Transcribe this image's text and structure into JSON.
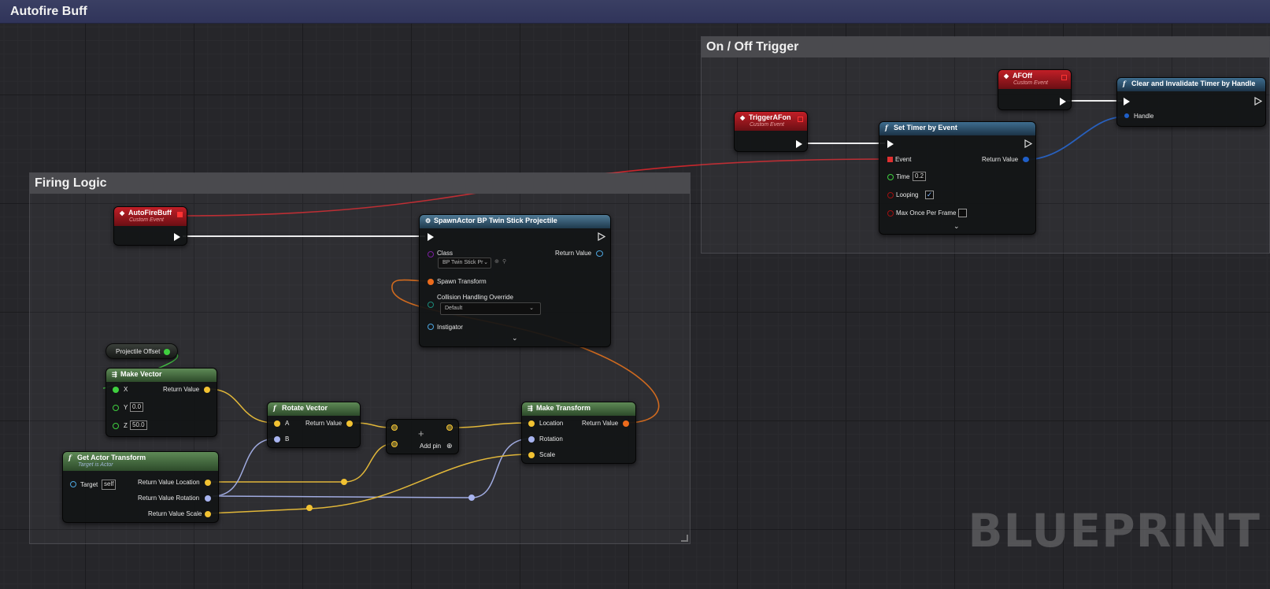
{
  "graph": {
    "title": "Autofire Buff"
  },
  "comments": {
    "on_off": "On / Off Trigger",
    "firing": "Firing Logic"
  },
  "nodes": {
    "af_off": {
      "title": "AFOff",
      "subtitle": "Custom Event"
    },
    "clear_timer": {
      "title": "Clear and Invalidate Timer by Handle",
      "handle": "Handle"
    },
    "trigger_af_on": {
      "title": "TriggerAFon",
      "subtitle": "Custom Event"
    },
    "set_timer": {
      "title": "Set Timer by Event",
      "event": "Event",
      "return_value": "Return Value",
      "time_label": "Time",
      "time_value": "0.2",
      "looping_label": "Looping",
      "looping_checked": true,
      "max_once_label": "Max Once Per Frame",
      "max_once_checked": false
    },
    "autofire_buff": {
      "title": "AutoFireBuff",
      "subtitle": "Custom Event"
    },
    "spawn_actor": {
      "title": "SpawnActor BP Twin Stick Projectile",
      "class_label": "Class",
      "class_value": "BP Twin Stick Pr",
      "return_value": "Return Value",
      "spawn_transform": "Spawn Transform",
      "collision_label": "Collision Handling Override",
      "collision_value": "Default",
      "instigator": "Instigator"
    },
    "projectile_offset": {
      "title": "Projectile Offset"
    },
    "make_vector": {
      "title": "Make Vector",
      "x_label": "X",
      "y_label": "Y",
      "y_value": "0.0",
      "z_label": "Z",
      "z_value": "50.0",
      "return_value": "Return Value"
    },
    "rotate_vector": {
      "title": "Rotate Vector",
      "a": "A",
      "b": "B",
      "return_value": "Return Value"
    },
    "add": {
      "add_pin": "Add pin",
      "plus": "+"
    },
    "make_transform": {
      "title": "Make Transform",
      "location": "Location",
      "rotation": "Rotation",
      "scale": "Scale",
      "return_value": "Return Value"
    },
    "get_actor_transform": {
      "title": "Get Actor Transform",
      "subtitle": "Target is Actor",
      "target_label": "Target",
      "target_value": "self",
      "rv_location": "Return Value Location",
      "rv_rotation": "Return Value Rotation",
      "rv_scale": "Return Value Scale"
    }
  },
  "watermark": "BLUEPRINT",
  "colors": {
    "exec": "#ffffff",
    "delegate": "#e03030",
    "vector": "#f2c232",
    "rotator": "#a8b4ef",
    "transform": "#ec6b1c",
    "float": "#3fcf3f",
    "object": "#4da6e0",
    "handle": "#1f5fc8",
    "boolean": "#8b0000"
  }
}
